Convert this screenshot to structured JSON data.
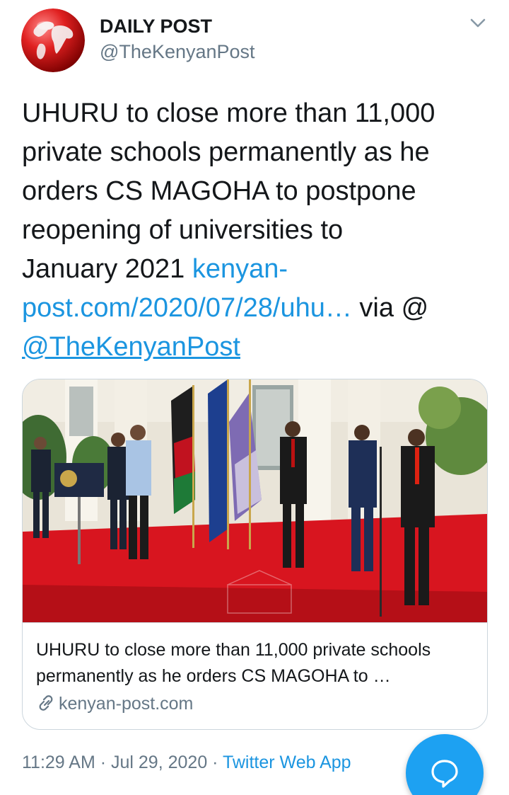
{
  "tweet": {
    "author": {
      "display_name": "DAILY POST",
      "handle": "@TheKenyanPost"
    },
    "text": {
      "line1": "UHURU to close more than 11,000",
      "line2": "private schools permanently as he",
      "line3": "orders CS MAGOHA to postpone",
      "line4": "reopening of universities to",
      "line5_plain": "January 2021 ",
      "line5_link": "kenyan-",
      "line6_link": "post.com/2020/07/28/uhu…",
      "line6_plain": " via @",
      "line7_mention": "@TheKenyanPost"
    },
    "card": {
      "title_line1": "UHURU to close more than 11,000 private schools",
      "title_line2": "permanently as he orders CS MAGOHA to …",
      "domain": "kenyan-post.com"
    },
    "meta": {
      "time": "11:29 AM",
      "separator1": " · ",
      "date": "Jul 29, 2020",
      "separator2": " · ",
      "source": "Twitter Web App"
    }
  },
  "colors": {
    "link": "#1b95e0",
    "muted": "#657786",
    "fab": "#1da1f2",
    "border": "#ccd6dd"
  },
  "icons": {
    "more": "chevron-down-icon",
    "link": "link-icon",
    "fab": "reply-bubble-icon"
  }
}
